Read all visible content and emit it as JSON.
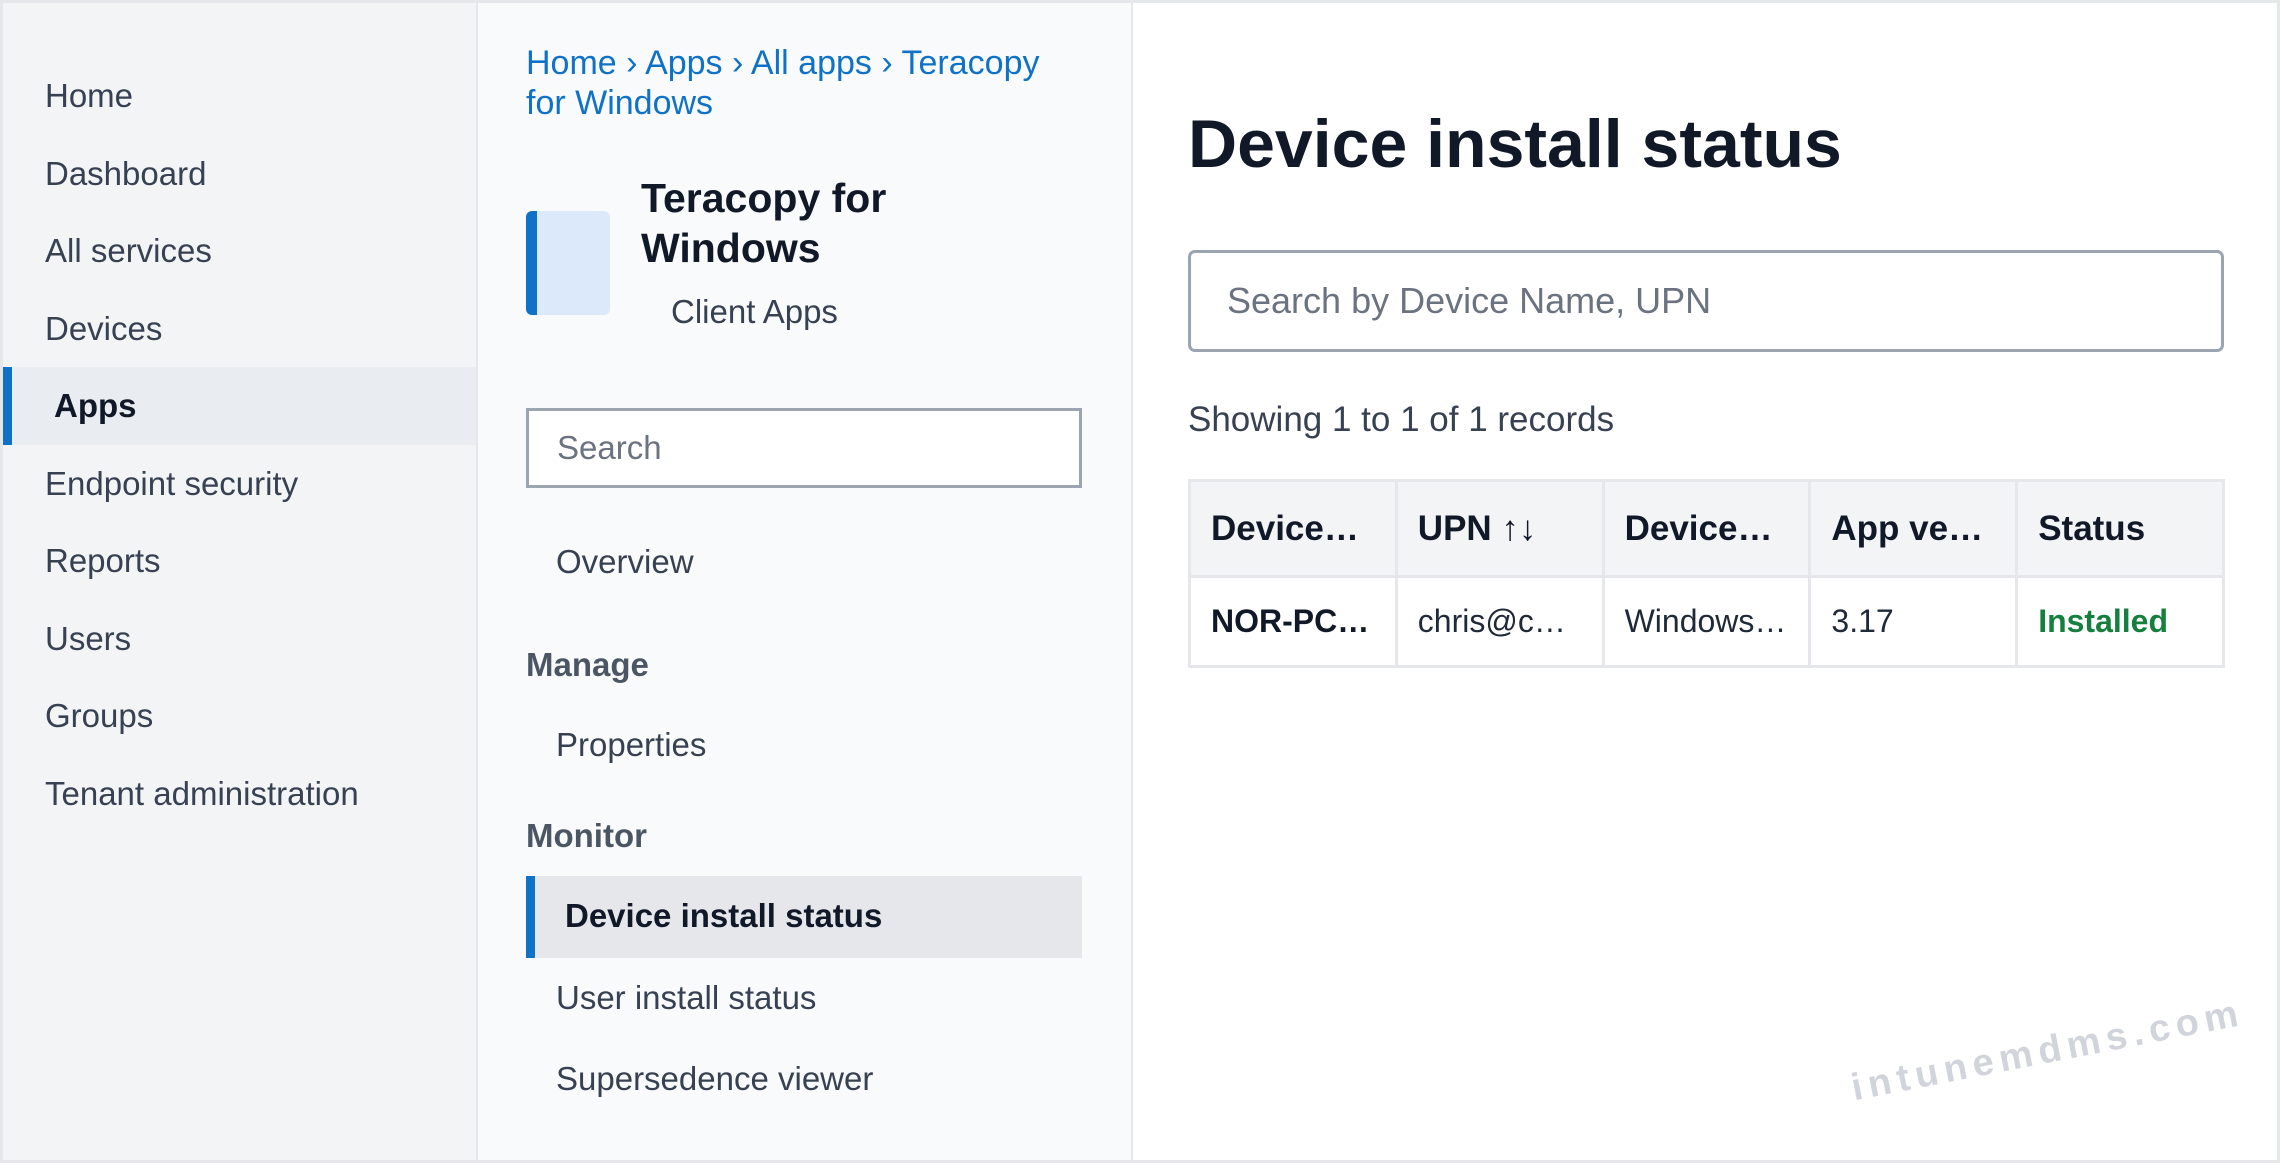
{
  "nav": {
    "items": [
      {
        "label": "Home"
      },
      {
        "label": "Dashboard"
      },
      {
        "label": "All services"
      },
      {
        "label": "Devices"
      },
      {
        "label": "Apps"
      },
      {
        "label": "Endpoint security"
      },
      {
        "label": "Reports"
      },
      {
        "label": "Users"
      },
      {
        "label": "Groups"
      },
      {
        "label": "Tenant administration"
      }
    ],
    "active": "Apps"
  },
  "breadcrumb": {
    "items": [
      "Home",
      "Apps",
      "All apps",
      "Teracopy for Windows"
    ],
    "separator": "›"
  },
  "app": {
    "name": "Teracopy for Windows",
    "category": "Client Apps",
    "accent": "#0f72c7"
  },
  "blade": {
    "search_placeholder": "Search",
    "overview": "Overview",
    "manage_heading": "Manage",
    "properties": "Properties",
    "monitor_heading": "Monitor",
    "device_install_status": "Device install status",
    "user_install_status": "User install status",
    "supersedence_viewer": "Supersedence viewer"
  },
  "main": {
    "title": "Device install status",
    "search_placeholder": "Search by Device Name, UPN",
    "records_text": "Showing 1 to 1 of 1 records",
    "columns": [
      "Device…",
      "UPN ↑↓",
      "Device…",
      "App ve…",
      "Status"
    ],
    "rows": [
      {
        "device": "NOR-PC…",
        "upn": "chris@c…",
        "platform": "Windows…",
        "app_version": "3.17",
        "status": "Installed"
      }
    ],
    "status_color": "#15803d"
  },
  "watermark": "intunemdms.com"
}
